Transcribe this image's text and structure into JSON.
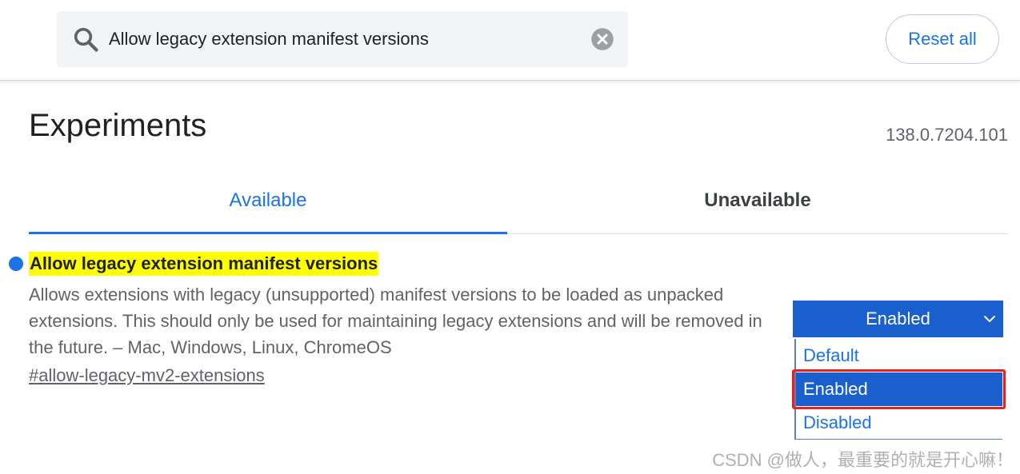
{
  "search": {
    "query": "Allow legacy extension manifest versions",
    "icon": "search-icon",
    "clear_icon": "clear-icon"
  },
  "header": {
    "reset_label": "Reset all"
  },
  "page": {
    "title": "Experiments",
    "version": "138.0.7204.101"
  },
  "tabs": [
    {
      "label": "Available",
      "active": true
    },
    {
      "label": "Unavailable",
      "active": false
    }
  ],
  "flag": {
    "title": "Allow legacy extension manifest versions",
    "description": "Allows extensions with legacy (unsupported) manifest versions to be loaded as unpacked extensions. This should only be used for maintaining legacy extensions and will be removed in the future. – Mac, Windows, Linux, ChromeOS",
    "link": "#allow-legacy-mv2-extensions",
    "select": {
      "value": "Enabled",
      "options": [
        "Default",
        "Enabled",
        "Disabled"
      ]
    }
  },
  "watermark": "CSDN @做人，最重要的就是开心嘛！",
  "colors": {
    "accent": "#1a73e8",
    "select_bg": "#1a5fce",
    "title_highlight": "#ffff00",
    "annotation_border": "#e8211f"
  }
}
